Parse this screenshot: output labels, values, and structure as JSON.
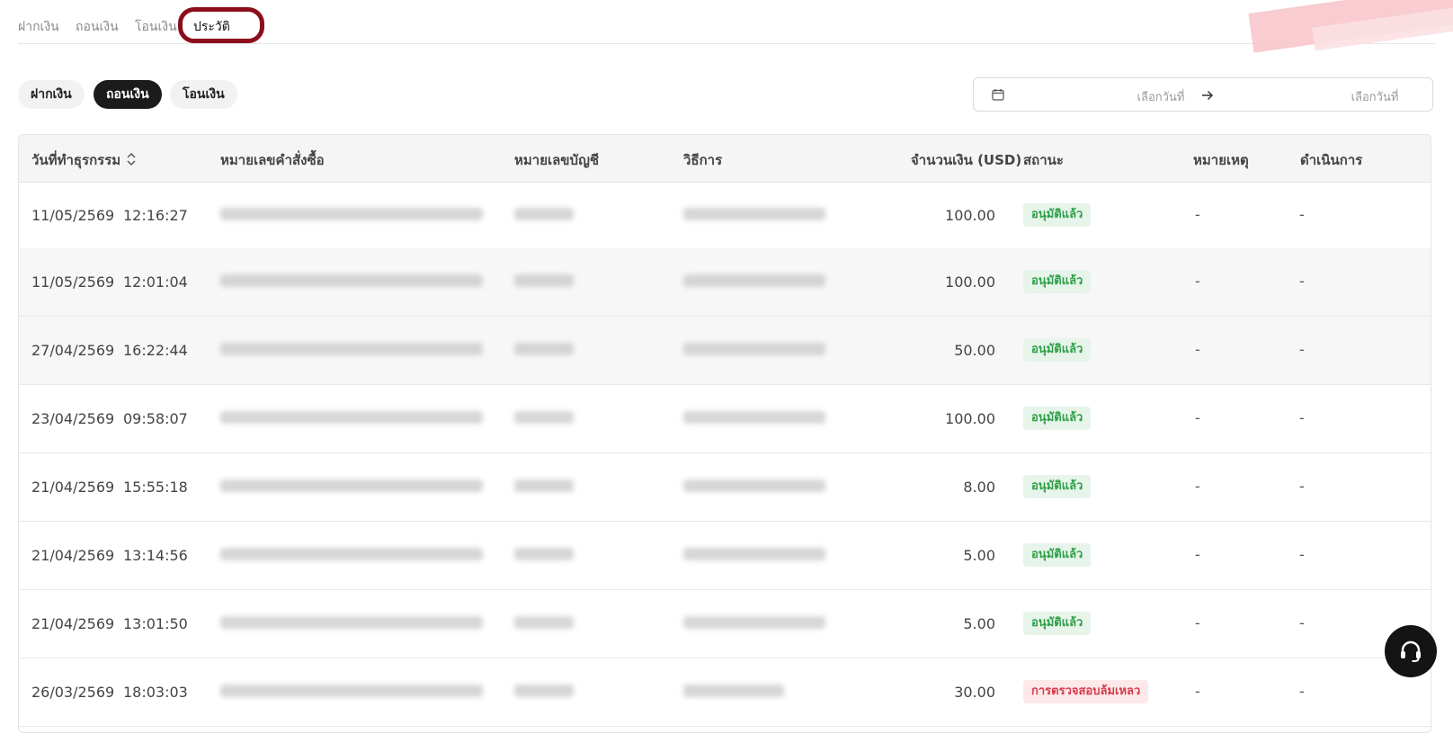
{
  "top_tabs": [
    {
      "label": "ฝากเงิน"
    },
    {
      "label": "ถอนเงิน"
    },
    {
      "label": "โอนเงิน"
    },
    {
      "label": "ประวัติ"
    }
  ],
  "filters": [
    {
      "label": "ฝากเงิน"
    },
    {
      "label": "ถอนเงิน"
    },
    {
      "label": "โอนเงิน"
    }
  ],
  "active_filter": "ถอนเงิน",
  "date_range": {
    "start_placeholder": "เลือกวันที่",
    "end_placeholder": "เลือกวันที่",
    "icon": "calendar-icon"
  },
  "table": {
    "columns": [
      "วันที่ทำธุรกรรม",
      "หมายเลขคำสั่งซื้อ",
      "หมายเลขบัญชี",
      "วิธีการ",
      "จำนวนเงิน (USD)",
      "สถานะ",
      "หมายเหตุ",
      "ดำเนินการ"
    ],
    "rows": [
      {
        "date": "11/05/2569",
        "time": "12:16:27",
        "amount": "100.00",
        "status": "อนุมัติแล้ว",
        "status_type": "ok",
        "note": "-",
        "action": "-"
      },
      {
        "date": "11/05/2569",
        "time": "12:01:04",
        "amount": "100.00",
        "status": "อนุมัติแล้ว",
        "status_type": "ok",
        "note": "-",
        "action": "-"
      },
      {
        "date": "27/04/2569",
        "time": "16:22:44",
        "amount": "50.00",
        "status": "อนุมัติแล้ว",
        "status_type": "ok",
        "note": "-",
        "action": "-"
      },
      {
        "date": "23/04/2569",
        "time": "09:58:07",
        "amount": "100.00",
        "status": "อนุมัติแล้ว",
        "status_type": "ok",
        "note": "-",
        "action": "-"
      },
      {
        "date": "21/04/2569",
        "time": "15:55:18",
        "amount": "8.00",
        "status": "อนุมัติแล้ว",
        "status_type": "ok",
        "note": "-",
        "action": "-"
      },
      {
        "date": "21/04/2569",
        "time": "13:14:56",
        "amount": "5.00",
        "status": "อนุมัติแล้ว",
        "status_type": "ok",
        "note": "-",
        "action": "-"
      },
      {
        "date": "21/04/2569",
        "time": "13:01:50",
        "amount": "5.00",
        "status": "อนุมัติแล้ว",
        "status_type": "ok",
        "note": "-",
        "action": "-"
      },
      {
        "date": "26/03/2569",
        "time": "18:03:03",
        "amount": "30.00",
        "status": "การตรวจสอบล้มเหลว",
        "status_type": "fail",
        "note": "-",
        "action": "-"
      }
    ]
  },
  "colors": {
    "active_pill": "#1b1b1b",
    "approved_bg": "#e6f4ea",
    "approved_text": "#2f9e47",
    "failed_bg": "#fde8ea",
    "failed_text": "#d83a4b",
    "highlight_ring": "#8b0e1a"
  },
  "support_icon": "headset-icon"
}
